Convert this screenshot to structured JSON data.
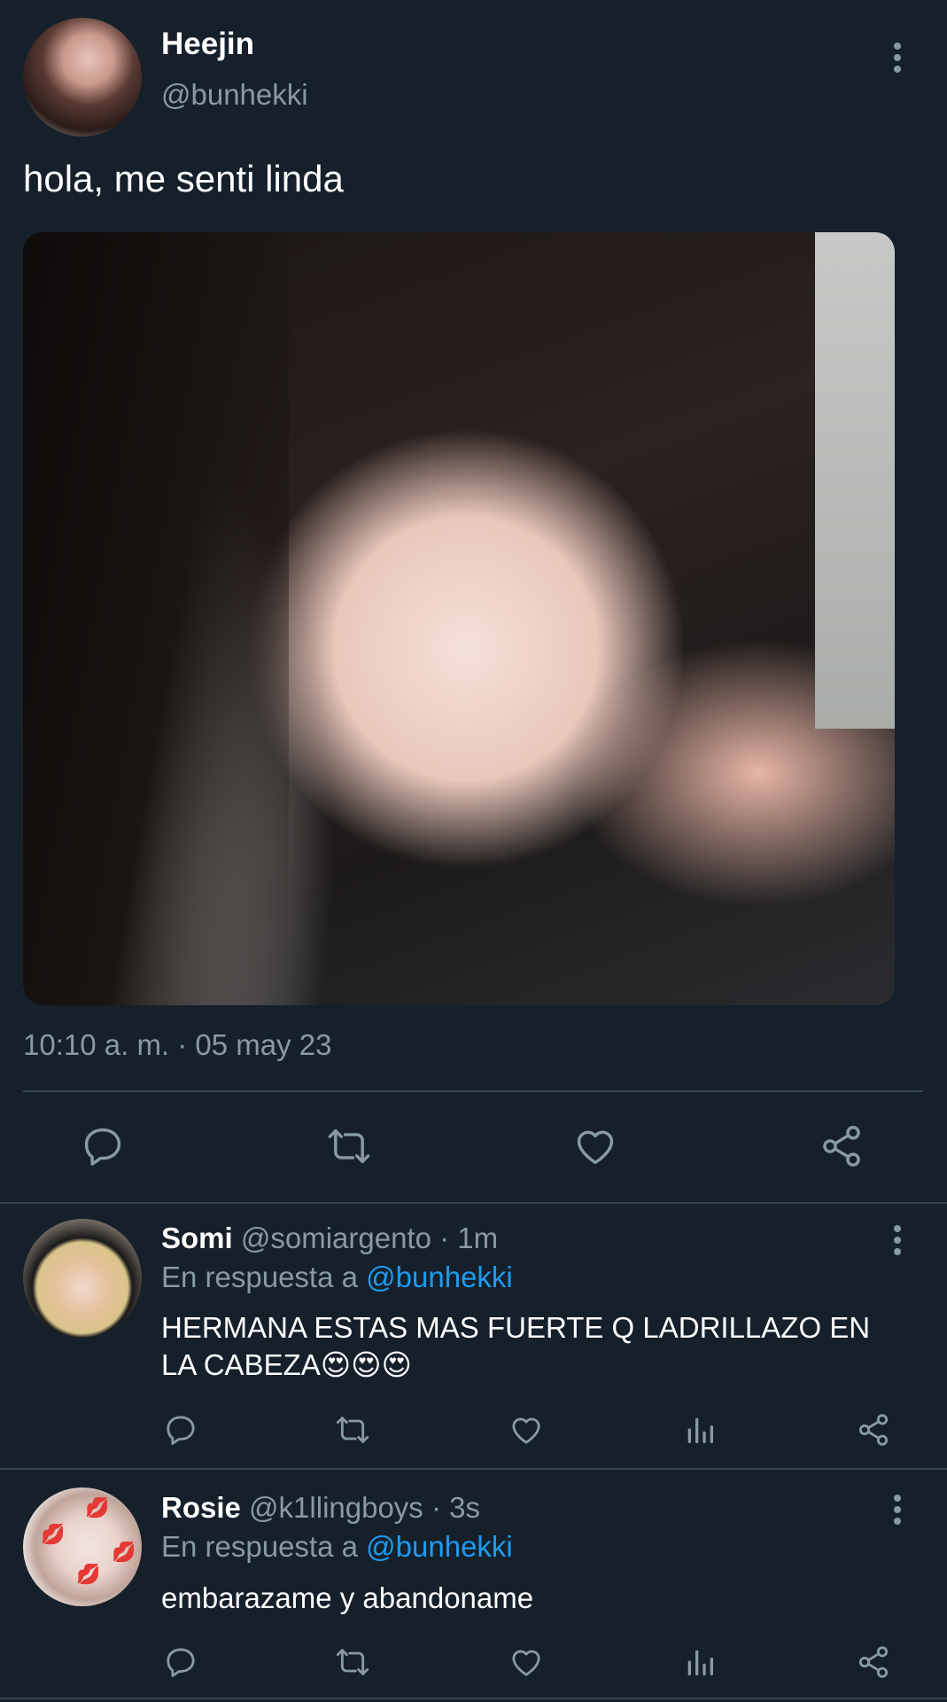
{
  "tweet": {
    "author_name": "Heejin",
    "author_handle": "@bunhekki",
    "text": "hola, me senti linda",
    "timestamp": "10:10 a. m. · 05 may 23",
    "actions": [
      "reply-icon",
      "retweet-icon",
      "like-icon",
      "share-icon"
    ]
  },
  "replies": [
    {
      "name": "Somi",
      "meta": "@somiargento · 1m",
      "reply_prefix": "En respuesta a ",
      "reply_mention": "@bunhekki",
      "text": "HERMANA ESTAS MAS FUERTE Q LADRILLAZO EN LA CABEZA😍😍😍",
      "actions": [
        "reply-icon",
        "retweet-icon",
        "like-icon",
        "stats-icon",
        "share-icon"
      ]
    },
    {
      "name": "Rosie",
      "meta": "@k1llingboys · 3s",
      "reply_prefix": "En respuesta a ",
      "reply_mention": "@bunhekki",
      "text": "embarazame y abandoname",
      "actions": [
        "reply-icon",
        "retweet-icon",
        "like-icon",
        "stats-icon",
        "share-icon"
      ]
    }
  ],
  "colors": {
    "background": "#15202b",
    "secondary_text": "#8899a6",
    "mention": "#1d9bf0",
    "divider": "#38444d"
  }
}
